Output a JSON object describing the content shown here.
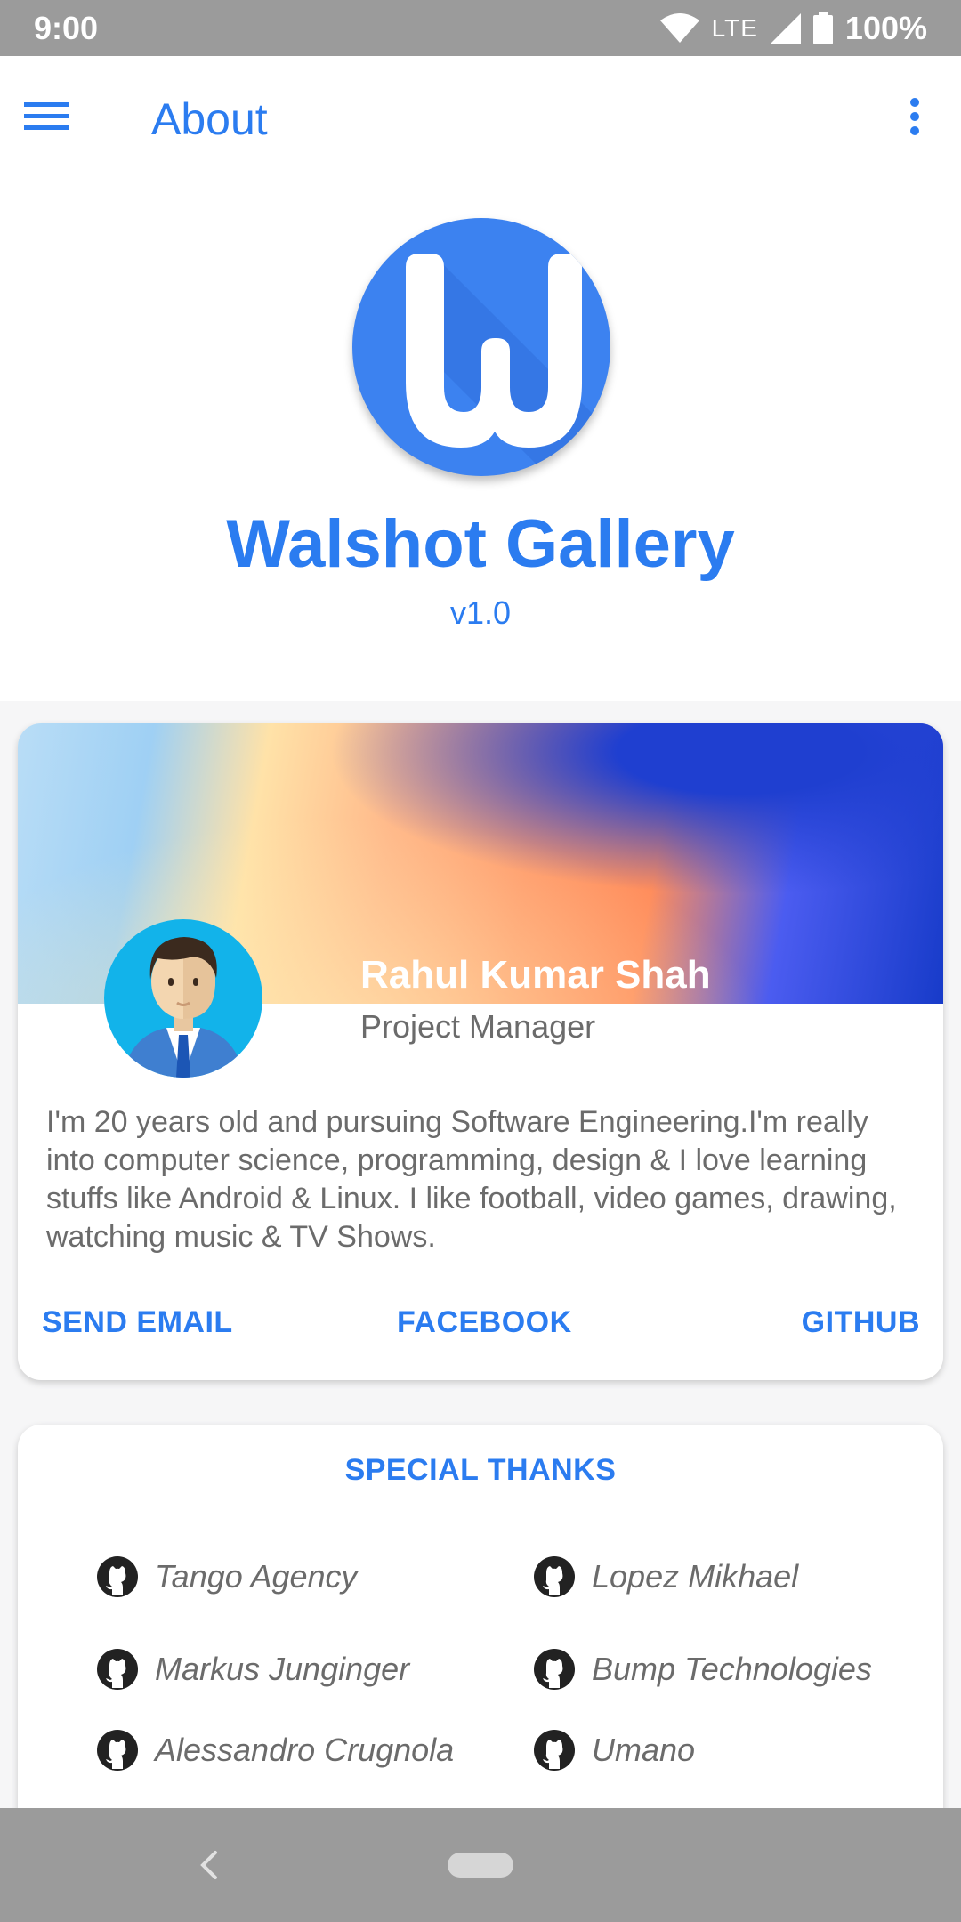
{
  "status_bar": {
    "time": "9:00",
    "network": "LTE",
    "battery": "100%",
    "icons": [
      "wifi-icon",
      "signal-icon",
      "battery-icon"
    ]
  },
  "app_bar": {
    "title": "About",
    "menu_icon": "hamburger-menu-icon",
    "overflow_icon": "more-vertical-icon"
  },
  "app": {
    "name": "Walshot Gallery",
    "version": "v1.0",
    "logo_icon": "walshot-logo-icon"
  },
  "profile": {
    "name": "Rahul Kumar Shah",
    "role": "Project Manager",
    "bio": "I'm 20 years old and pursuing Software Engineering.I'm really into computer science, programming, design & I love learning stuffs like Android & Linux. I like football, video games, drawing, watching music & TV Shows.",
    "actions": {
      "email": "SEND EMAIL",
      "facebook": "FACEBOOK",
      "github": "GITHUB"
    }
  },
  "special_thanks": {
    "title": "SPECIAL THANKS",
    "items": [
      "Tango Agency",
      "Lopez Mikhael",
      "Markus Junginger",
      "Bump Technologies",
      "Alessandro Crugnola",
      "Umano"
    ]
  },
  "colors": {
    "accent": "#2b7cf0",
    "status_bar": "#9b9b9b",
    "text_secondary": "#6b6b6b"
  }
}
